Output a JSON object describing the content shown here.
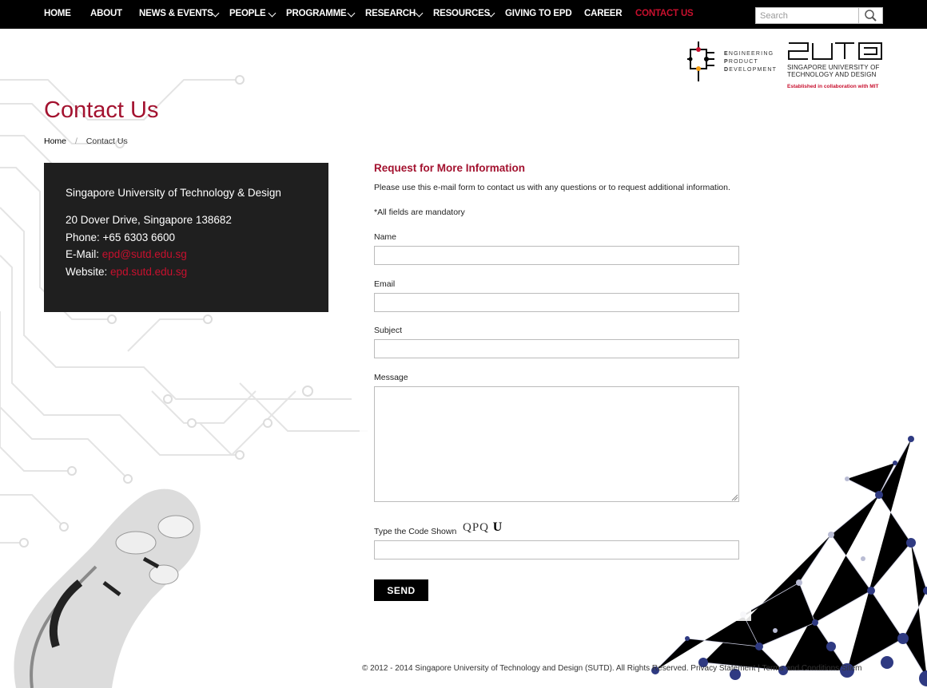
{
  "nav": {
    "items": [
      {
        "label": "HOME"
      },
      {
        "label": "ABOUT"
      },
      {
        "label": "NEWS & EVENTS"
      },
      {
        "label": "PEOPLE"
      },
      {
        "label": "PROGRAMME"
      },
      {
        "label": "RESEARCH"
      },
      {
        "label": "RESOURCES"
      },
      {
        "label": "GIVING TO EPD"
      },
      {
        "label": "CAREER"
      },
      {
        "label": "CONTACT US"
      }
    ],
    "active_color": "#c8102e",
    "search_placeholder": "Search"
  },
  "logos": {
    "epd_letters": [
      "E",
      "P",
      "D"
    ],
    "epd_words": [
      "NGINEERING",
      "RODUCT",
      "EVELOPMENT"
    ],
    "sutd_line1": "SINGAPORE UNIVERSITY OF",
    "sutd_line2": "TECHNOLOGY AND DESIGN",
    "sutd_tagline": "Established in collaboration with MIT"
  },
  "page": {
    "title": "Contact Us",
    "breadcrumb": {
      "home": "Home",
      "current": "Contact Us"
    }
  },
  "contact": {
    "org": "Singapore University of Technology & Design",
    "address": "20 Dover Drive, Singapore 138682",
    "phone": "Phone: +65 6303 6600",
    "email_label": "E-Mail:",
    "email": "epd@sutd.edu.sg",
    "website_label": "Website:",
    "website": "epd.sutd.edu.sg"
  },
  "form": {
    "title": "Request for More Information",
    "description": "Please use this e-mail form to contact us with any questions or to request additional information.",
    "mandatory_note": "*All fields are mandatory",
    "name_label": "Name",
    "email_label": "Email",
    "subject_label": "Subject",
    "message_label": "Message",
    "captcha_label": "Type the Code Shown",
    "captcha_code": "QPQ",
    "captcha_code_bold": "U",
    "send_label": "SEND"
  },
  "footer": {
    "copyright": "© 2012 - 2014 Singapore University of Technology and Design (SUTD). All Rights Reserved.",
    "privacy": "Privacy Statement",
    "separator": "|",
    "terms": "Terms and Conditions",
    "trailing": "Sitem"
  },
  "colors": {
    "brand": "#a3122f",
    "nav_bg": "#000000",
    "panel_bg": "#1f1f1f"
  }
}
